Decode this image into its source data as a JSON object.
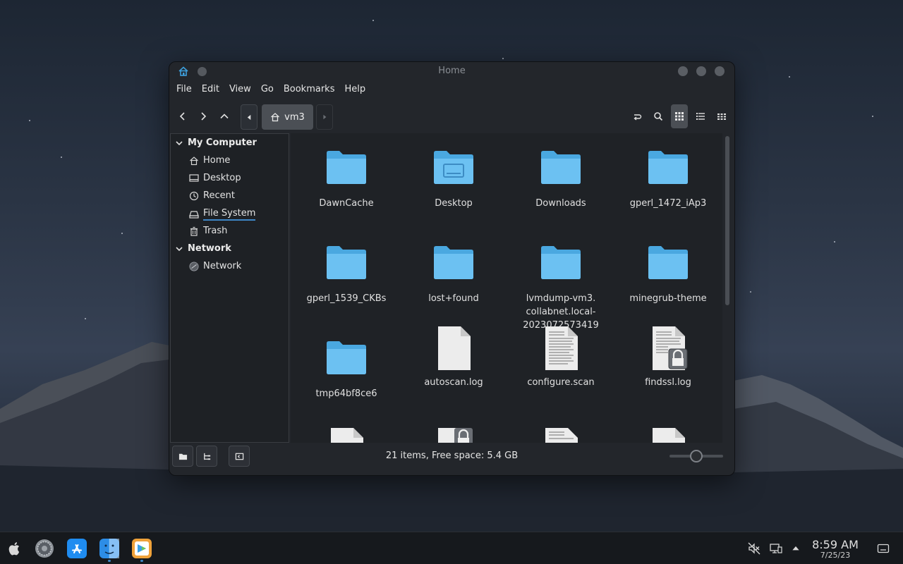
{
  "window": {
    "title": "Home",
    "icons": {
      "app": "home-folder-icon"
    }
  },
  "menu": [
    "File",
    "Edit",
    "View",
    "Go",
    "Bookmarks",
    "Help"
  ],
  "toolbar": {
    "breadcrumb": "vm3",
    "icons": [
      "back-icon",
      "forward-icon",
      "up-icon",
      "toggle-location-icon",
      "search-icon",
      "icon-view-icon",
      "list-view-icon",
      "compact-view-icon"
    ]
  },
  "sidebar": {
    "sections": [
      {
        "title": "My Computer",
        "items": [
          {
            "label": "Home",
            "icon": "home-icon"
          },
          {
            "label": "Desktop",
            "icon": "desktop-icon"
          },
          {
            "label": "Recent",
            "icon": "clock-icon"
          },
          {
            "label": "File System",
            "icon": "drive-icon"
          },
          {
            "label": "Trash",
            "icon": "trash-icon"
          }
        ]
      },
      {
        "title": "Network",
        "items": [
          {
            "label": "Network",
            "icon": "network-icon"
          }
        ]
      }
    ]
  },
  "files": [
    {
      "name": "DawnCache",
      "type": "folder"
    },
    {
      "name": "Desktop",
      "type": "desktop-folder"
    },
    {
      "name": "Downloads",
      "type": "folder"
    },
    {
      "name": "gperl_1472_iAp3",
      "type": "folder"
    },
    {
      "name": "gperl_1539_CKBs",
      "type": "folder"
    },
    {
      "name": "lost+found",
      "type": "folder"
    },
    {
      "name": "lvmdump-vm3.\ncollabnet.local-\n2023072573419",
      "type": "folder"
    },
    {
      "name": "minegrub-theme",
      "type": "folder"
    },
    {
      "name": "tmp64bf8ce6",
      "type": "folder"
    },
    {
      "name": "autoscan.log",
      "type": "blank-file"
    },
    {
      "name": "configure.scan",
      "type": "text-file"
    },
    {
      "name": "findssl.log",
      "type": "locked-text-file"
    }
  ],
  "statusbar": {
    "text": "21 items, Free space: 5.4 GB",
    "zoom_level": 0.5
  },
  "dock": {
    "apps": [
      "apple-icon",
      "settings-icon",
      "app-store-icon",
      "finder-icon",
      "software-center-icon"
    ],
    "tray": [
      "audio-muted-icon",
      "network-wired-icon",
      "tray-expand-icon",
      "show-desktop-icon"
    ],
    "time": "8:59 AM",
    "date": "7/25/23"
  }
}
